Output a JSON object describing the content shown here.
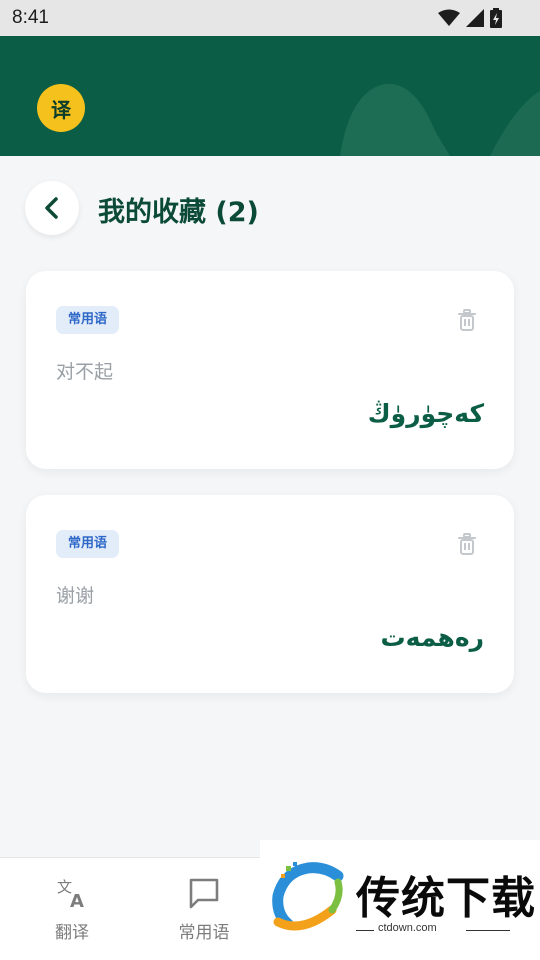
{
  "status_bar": {
    "time": "8:41"
  },
  "header": {
    "logo_text": "译"
  },
  "page": {
    "title": "我的收藏 (2)"
  },
  "favorites": [
    {
      "tag": "常用语",
      "source": "对不起",
      "translation": "كەچۈرۈڭ"
    },
    {
      "tag": "常用语",
      "source": "谢谢",
      "translation": "رەھمەت"
    }
  ],
  "bottom_nav": {
    "items": [
      {
        "label": "翻译",
        "icon": "translate-icon"
      },
      {
        "label": "常用语",
        "icon": "chat-bubble-icon"
      }
    ]
  },
  "watermark": {
    "text": "传统下载",
    "url": "ctdown.com"
  },
  "colors": {
    "primary": "#0b5e45",
    "accent": "#f5c11c",
    "tag_bg": "#e3ecf9",
    "tag_text": "#2f69c8"
  }
}
